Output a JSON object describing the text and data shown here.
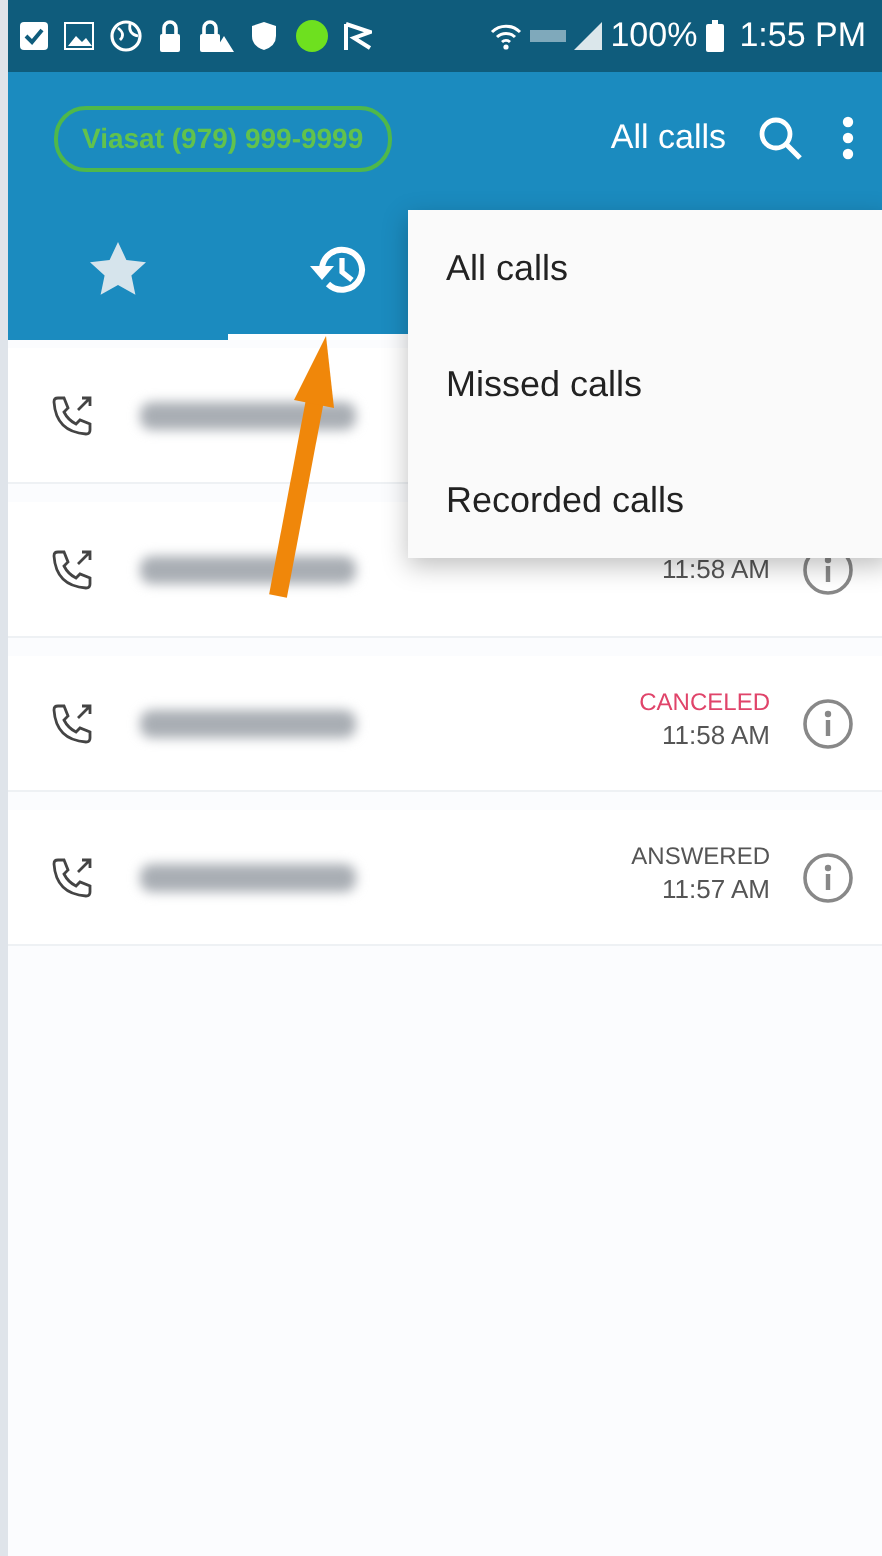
{
  "status_bar": {
    "battery": "100%",
    "time": "1:55 PM"
  },
  "toolbar": {
    "account": "Viasat (979) 999-9999",
    "filter": "All calls"
  },
  "tabs": [
    {
      "kind": "favorites",
      "selected": false
    },
    {
      "kind": "recents",
      "selected": true
    }
  ],
  "calls": [
    {
      "kind": "outgoing"
    },
    {
      "kind": "outgoing",
      "time": "11:58 AM"
    },
    {
      "kind": "outgoing",
      "status": "CANCELED",
      "color": "#e0446a",
      "time": "11:58 AM"
    },
    {
      "kind": "outgoing",
      "status": "ANSWERED",
      "color": "#555555",
      "time": "11:57 AM"
    }
  ],
  "menu": [
    {
      "label": "All calls"
    },
    {
      "label": "Missed calls"
    },
    {
      "label": "Recorded calls"
    }
  ]
}
